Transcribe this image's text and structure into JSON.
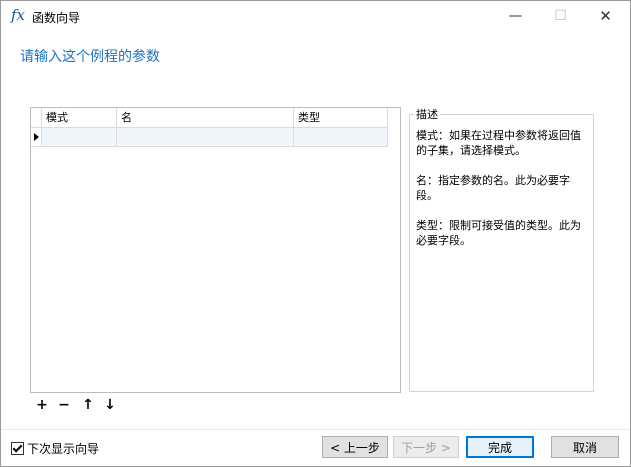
{
  "window": {
    "title": "函数向导",
    "icon_label": "fx",
    "minimize_glyph": "—",
    "maximize_glyph": "☐",
    "close_glyph": "✕"
  },
  "heading": "请输入这个例程的参数",
  "grid": {
    "columns": [
      "模式",
      "名",
      "类型"
    ],
    "rows": [
      {
        "mode": "",
        "name": "",
        "type": ""
      }
    ]
  },
  "toolbar": {
    "add": "+",
    "remove": "−",
    "up": "↑",
    "down": "↓"
  },
  "description": {
    "title": "描述",
    "paragraphs": [
      "模式：如果在过程中参数将返回值的子集，请选择模式。",
      "名：指定参数的名。此为必要字段。",
      "类型：限制可接受值的类型。此为必要字段。"
    ]
  },
  "footer": {
    "show_checkbox_label": "下次显示向导",
    "show_checkbox_checked": true,
    "prev_label": "< 上一步",
    "next_label": "下一步 >",
    "finish_label": "完成",
    "cancel_label": "取消"
  },
  "colors": {
    "heading": "#1f73c6",
    "default_button_border": "#0078d7"
  }
}
